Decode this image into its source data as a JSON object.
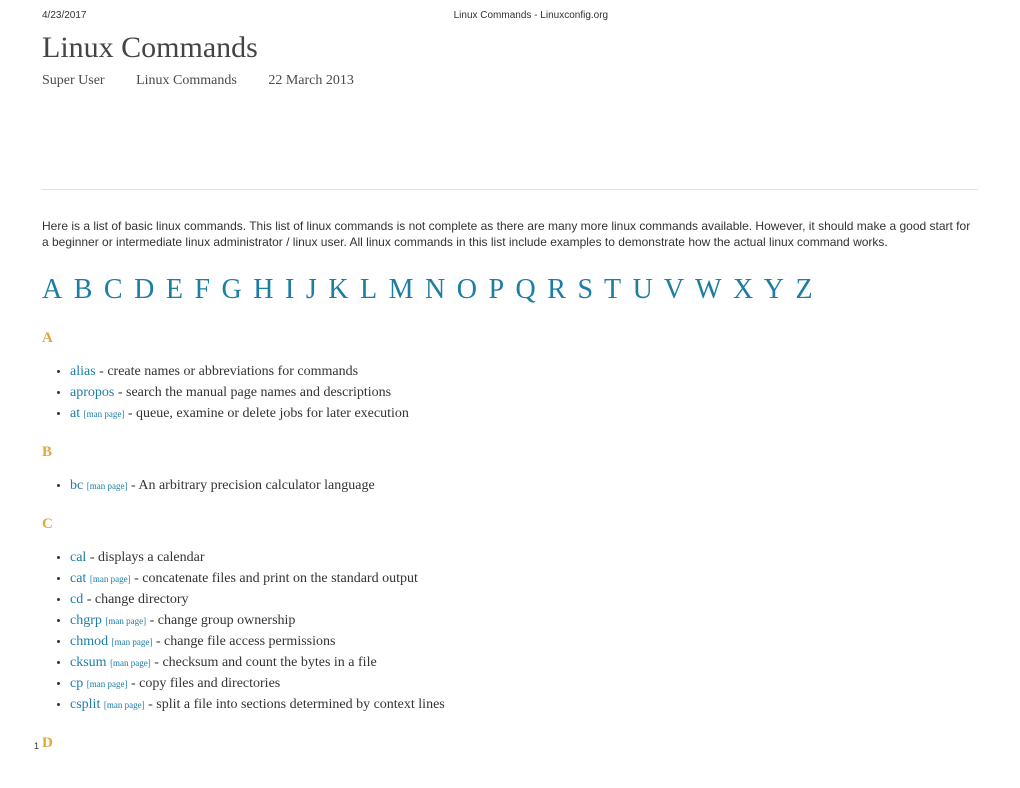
{
  "header": {
    "date": "4/23/2017",
    "site": "Linux Commands - Linuxconfig.org"
  },
  "page": {
    "title": "Linux Commands",
    "author": "Super User",
    "category": "Linux Commands",
    "published": "22 March 2013",
    "intro": "Here is a list of basic linux commands. This list of linux commands is not complete as there are many more linux commands available. However, it should make a good start for a beginner or intermediate linux administrator / linux user. All linux commands in this list include examples to demonstrate how the actual linux command works.",
    "page_number": "1"
  },
  "alphabet": [
    "A",
    "B",
    "C",
    "D",
    "E",
    "F",
    "G",
    "H",
    "I",
    "J",
    "K",
    "L",
    "M",
    "N",
    "O",
    "P",
    "Q",
    "R",
    "S",
    "T",
    "U",
    "V",
    "W",
    "X",
    "Y",
    "Z"
  ],
  "man_label": "[man page]",
  "sections": [
    {
      "letter": "A",
      "items": [
        {
          "cmd": "alias",
          "man": false,
          "desc": "create names or abbreviations for commands"
        },
        {
          "cmd": "apropos",
          "man": false,
          "desc": "search the manual page names and descriptions"
        },
        {
          "cmd": "at",
          "man": true,
          "desc": "queue, examine or delete jobs for later execution"
        }
      ]
    },
    {
      "letter": "B",
      "items": [
        {
          "cmd": "bc",
          "man": true,
          "desc": "An arbitrary precision calculator language"
        }
      ]
    },
    {
      "letter": "C",
      "items": [
        {
          "cmd": "cal",
          "man": false,
          "desc": "displays a calendar"
        },
        {
          "cmd": "cat",
          "man": true,
          "desc": "concatenate files and print on the standard output"
        },
        {
          "cmd": "cd",
          "man": false,
          "desc": "change directory"
        },
        {
          "cmd": "chgrp",
          "man": true,
          "desc": "change group ownership"
        },
        {
          "cmd": "chmod",
          "man": true,
          "desc": "change file access permissions"
        },
        {
          "cmd": "cksum",
          "man": true,
          "desc": "checksum and count the bytes in a file"
        },
        {
          "cmd": "cp",
          "man": true,
          "desc": "copy files and directories"
        },
        {
          "cmd": "csplit",
          "man": true,
          "desc": "split a file into sections determined by context lines"
        }
      ]
    },
    {
      "letter": "D",
      "items": []
    }
  ]
}
